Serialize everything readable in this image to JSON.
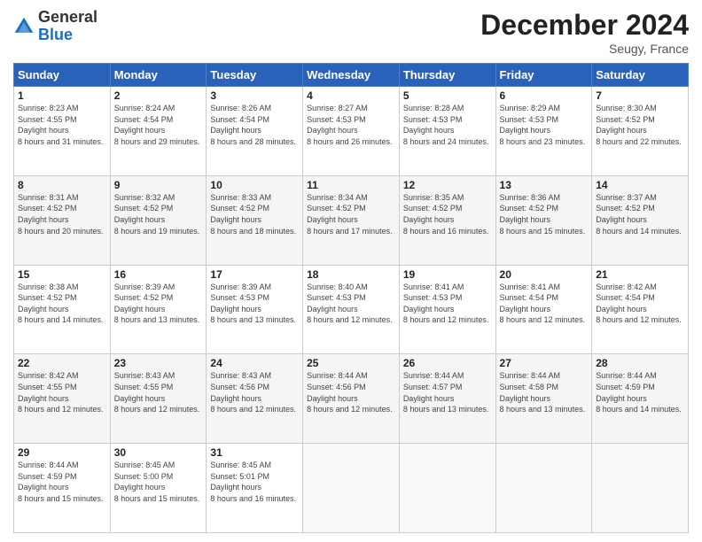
{
  "logo": {
    "general": "General",
    "blue": "Blue"
  },
  "header": {
    "month": "December 2024",
    "location": "Seugy, France"
  },
  "days_of_week": [
    "Sunday",
    "Monday",
    "Tuesday",
    "Wednesday",
    "Thursday",
    "Friday",
    "Saturday"
  ],
  "weeks": [
    [
      {
        "day": "1",
        "sunrise": "8:23 AM",
        "sunset": "4:55 PM",
        "daylight": "8 hours and 31 minutes."
      },
      {
        "day": "2",
        "sunrise": "8:24 AM",
        "sunset": "4:54 PM",
        "daylight": "8 hours and 29 minutes."
      },
      {
        "day": "3",
        "sunrise": "8:26 AM",
        "sunset": "4:54 PM",
        "daylight": "8 hours and 28 minutes."
      },
      {
        "day": "4",
        "sunrise": "8:27 AM",
        "sunset": "4:53 PM",
        "daylight": "8 hours and 26 minutes."
      },
      {
        "day": "5",
        "sunrise": "8:28 AM",
        "sunset": "4:53 PM",
        "daylight": "8 hours and 24 minutes."
      },
      {
        "day": "6",
        "sunrise": "8:29 AM",
        "sunset": "4:53 PM",
        "daylight": "8 hours and 23 minutes."
      },
      {
        "day": "7",
        "sunrise": "8:30 AM",
        "sunset": "4:52 PM",
        "daylight": "8 hours and 22 minutes."
      }
    ],
    [
      {
        "day": "8",
        "sunrise": "8:31 AM",
        "sunset": "4:52 PM",
        "daylight": "8 hours and 20 minutes."
      },
      {
        "day": "9",
        "sunrise": "8:32 AM",
        "sunset": "4:52 PM",
        "daylight": "8 hours and 19 minutes."
      },
      {
        "day": "10",
        "sunrise": "8:33 AM",
        "sunset": "4:52 PM",
        "daylight": "8 hours and 18 minutes."
      },
      {
        "day": "11",
        "sunrise": "8:34 AM",
        "sunset": "4:52 PM",
        "daylight": "8 hours and 17 minutes."
      },
      {
        "day": "12",
        "sunrise": "8:35 AM",
        "sunset": "4:52 PM",
        "daylight": "8 hours and 16 minutes."
      },
      {
        "day": "13",
        "sunrise": "8:36 AM",
        "sunset": "4:52 PM",
        "daylight": "8 hours and 15 minutes."
      },
      {
        "day": "14",
        "sunrise": "8:37 AM",
        "sunset": "4:52 PM",
        "daylight": "8 hours and 14 minutes."
      }
    ],
    [
      {
        "day": "15",
        "sunrise": "8:38 AM",
        "sunset": "4:52 PM",
        "daylight": "8 hours and 14 minutes."
      },
      {
        "day": "16",
        "sunrise": "8:39 AM",
        "sunset": "4:52 PM",
        "daylight": "8 hours and 13 minutes."
      },
      {
        "day": "17",
        "sunrise": "8:39 AM",
        "sunset": "4:53 PM",
        "daylight": "8 hours and 13 minutes."
      },
      {
        "day": "18",
        "sunrise": "8:40 AM",
        "sunset": "4:53 PM",
        "daylight": "8 hours and 12 minutes."
      },
      {
        "day": "19",
        "sunrise": "8:41 AM",
        "sunset": "4:53 PM",
        "daylight": "8 hours and 12 minutes."
      },
      {
        "day": "20",
        "sunrise": "8:41 AM",
        "sunset": "4:54 PM",
        "daylight": "8 hours and 12 minutes."
      },
      {
        "day": "21",
        "sunrise": "8:42 AM",
        "sunset": "4:54 PM",
        "daylight": "8 hours and 12 minutes."
      }
    ],
    [
      {
        "day": "22",
        "sunrise": "8:42 AM",
        "sunset": "4:55 PM",
        "daylight": "8 hours and 12 minutes."
      },
      {
        "day": "23",
        "sunrise": "8:43 AM",
        "sunset": "4:55 PM",
        "daylight": "8 hours and 12 minutes."
      },
      {
        "day": "24",
        "sunrise": "8:43 AM",
        "sunset": "4:56 PM",
        "daylight": "8 hours and 12 minutes."
      },
      {
        "day": "25",
        "sunrise": "8:44 AM",
        "sunset": "4:56 PM",
        "daylight": "8 hours and 12 minutes."
      },
      {
        "day": "26",
        "sunrise": "8:44 AM",
        "sunset": "4:57 PM",
        "daylight": "8 hours and 13 minutes."
      },
      {
        "day": "27",
        "sunrise": "8:44 AM",
        "sunset": "4:58 PM",
        "daylight": "8 hours and 13 minutes."
      },
      {
        "day": "28",
        "sunrise": "8:44 AM",
        "sunset": "4:59 PM",
        "daylight": "8 hours and 14 minutes."
      }
    ],
    [
      {
        "day": "29",
        "sunrise": "8:44 AM",
        "sunset": "4:59 PM",
        "daylight": "8 hours and 15 minutes."
      },
      {
        "day": "30",
        "sunrise": "8:45 AM",
        "sunset": "5:00 PM",
        "daylight": "8 hours and 15 minutes."
      },
      {
        "day": "31",
        "sunrise": "8:45 AM",
        "sunset": "5:01 PM",
        "daylight": "8 hours and 16 minutes."
      },
      null,
      null,
      null,
      null
    ]
  ],
  "labels": {
    "sunrise": "Sunrise:",
    "sunset": "Sunset:",
    "daylight": "Daylight hours"
  }
}
